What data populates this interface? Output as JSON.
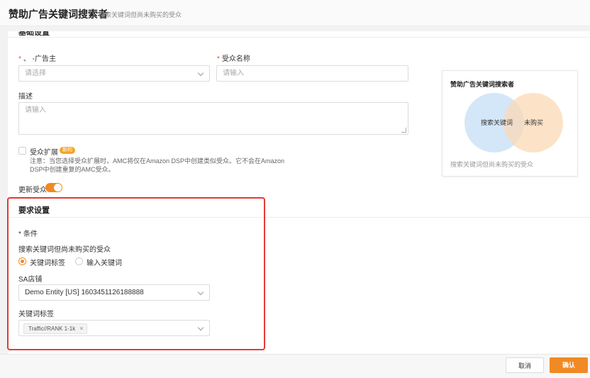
{
  "header": {
    "title": "赞助广告关键词搜索者",
    "subtitle": "搜索关键词但尚未购买的受众"
  },
  "basic": {
    "advertiser_label": "、 -广告主",
    "advertiser_placeholder": "请选择",
    "audience_name_label": "受众名称",
    "audience_name_placeholder": "请输入",
    "description_label": "描述",
    "description_placeholder": "请输入",
    "expand_label": "受众扩展",
    "expand_badge": "新的",
    "expand_note": "注意：当您选择受众扩展时，AMC将仅在Amazon DSP中创建类似受众。它不会在Amazon DSP中创建重复的AMC受众。",
    "update_label": "更新受众",
    "update_on": true
  },
  "requirements": {
    "title": "要求设置",
    "condition_label": "条件",
    "condition_text": "搜索关键词但尚未购买的受众",
    "radio_tags": "关键词标签",
    "radio_input": "输入关键词",
    "selected_radio": "关键词标签",
    "store_label": "SA店铺",
    "store_value": "Demo Entity [US] 1603451126188888",
    "keyword_tags_label": "关键词标签",
    "keyword_tag": "Traffic//RANK 1-1k"
  },
  "venn": {
    "title": "赞助广告关键词搜索者",
    "left_label": "搜索关键词",
    "right_label": "未购买",
    "caption": "搜索关键词但尚未购买的受众",
    "left_color": "#c9e1f8",
    "right_color": "#fbd9b6"
  },
  "footer": {
    "cancel_label": "取消",
    "confirm_label": "确认"
  },
  "colors": {
    "accent": "#f08a24",
    "highlight": "#e53935"
  }
}
